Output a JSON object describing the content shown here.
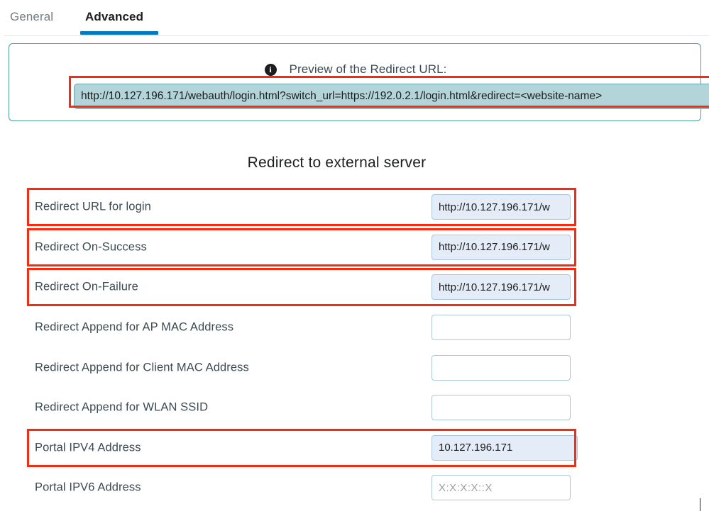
{
  "tabs": [
    {
      "label": "General",
      "active": false
    },
    {
      "label": "Advanced",
      "active": true
    }
  ],
  "preview": {
    "info_icon": "info-icon",
    "label": "Preview of the Redirect URL:",
    "url": "http://10.127.196.171/webauth/login.html?switch_url=https://192.0.2.1/login.html&redirect=<website-name>"
  },
  "section": {
    "title": "Redirect to external server"
  },
  "fields": [
    {
      "label": "Redirect URL for login",
      "value": "http://10.127.196.171/w",
      "placeholder": "",
      "filled": true,
      "highlighted": true
    },
    {
      "label": "Redirect On-Success",
      "value": "http://10.127.196.171/w",
      "placeholder": "",
      "filled": true,
      "highlighted": true
    },
    {
      "label": "Redirect On-Failure",
      "value": "http://10.127.196.171/w",
      "placeholder": "",
      "filled": true,
      "highlighted": true
    },
    {
      "label": "Redirect Append for AP MAC Address",
      "value": "",
      "placeholder": "",
      "filled": false,
      "highlighted": false
    },
    {
      "label": "Redirect Append for Client MAC Address",
      "value": "",
      "placeholder": "",
      "filled": false,
      "highlighted": false
    },
    {
      "label": "Redirect Append for WLAN SSID",
      "value": "",
      "placeholder": "",
      "filled": false,
      "highlighted": false
    },
    {
      "label": "Portal IPV4 Address",
      "value": "10.127.196.171",
      "placeholder": "",
      "filled": true,
      "highlighted": true
    },
    {
      "label": "Portal IPV6 Address",
      "value": "",
      "placeholder": "X:X:X:X::X",
      "filled": false,
      "highlighted": false
    }
  ],
  "colors": {
    "tab_active": "#007ac2",
    "highlight_box": "#fa2a10",
    "panel_border": "#4e9e9e",
    "preview_field_bg": "#b3d4d8",
    "input_filled_bg": "#e4ecf7",
    "input_border": "#a9c6df",
    "label_text": "#3c4a52"
  }
}
